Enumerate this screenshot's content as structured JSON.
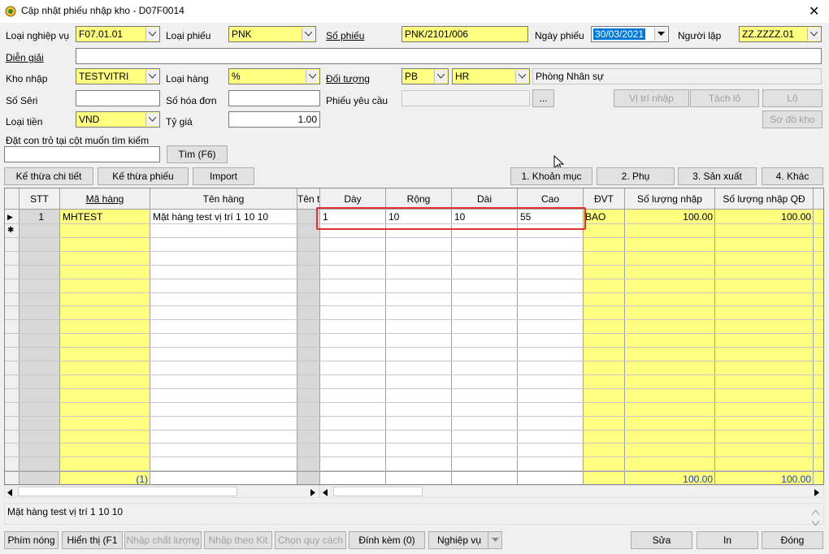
{
  "window": {
    "title": "Cập nhật phiếu nhập kho - D07F0014",
    "close_glyph": "✕"
  },
  "form": {
    "loai_nghiep_vu": {
      "label": "Loại nghiệp vụ",
      "value": "F07.01.01"
    },
    "loai_phieu": {
      "label": "Loại phiếu",
      "value": "PNK"
    },
    "so_phieu": {
      "label": "Số phiếu",
      "value": "PNK/2101/006"
    },
    "ngay_phieu": {
      "label": "Ngày phiếu",
      "value": "30/03/2021"
    },
    "nguoi_lap": {
      "label": "Người lập",
      "value": "ZZ.ZZZZ.01"
    },
    "dien_giai": {
      "label": "Diễn giải",
      "value": ""
    },
    "kho_nhap": {
      "label": "Kho nhập",
      "value": "TESTVITRI"
    },
    "loai_hang": {
      "label": "Loại hàng",
      "value": "%"
    },
    "doi_tuong": {
      "label": "Đối tượng",
      "value1": "PB",
      "value2": "HR",
      "name": "Phòng Nhân sự"
    },
    "so_seri": {
      "label": "Số Sêri",
      "value": ""
    },
    "so_hoa_don": {
      "label": "Số hóa đơn",
      "value": ""
    },
    "phieu_yeu_cau": {
      "label": "Phiếu yêu cầu",
      "value": "",
      "browse": "..."
    },
    "loai_tien": {
      "label": "Loại tiền",
      "value": "VND"
    },
    "ty_gia": {
      "label": "Tỷ giá",
      "value": "1.00"
    },
    "search": {
      "label": "Đặt con trỏ tại cột muốn tìm kiếm",
      "value": "",
      "button": "Tìm (F6)"
    }
  },
  "side_buttons": {
    "vi_tri_nhap": "Vị trí nhập",
    "tach_lo": "Tách lô",
    "lo": "Lô",
    "so_do_kho": "Sơ đồ kho"
  },
  "tabs_left": {
    "ke_thua_chi_tiet": "Kế thừa chi tiết",
    "ke_thua_phieu": "Kế thừa phiếu",
    "import": "Import"
  },
  "tabs_right": {
    "khoan_muc": "1. Khoản mục",
    "phu": "2. Phụ",
    "san_xuat": "3. Sản xuất",
    "khac": "4. Khác"
  },
  "grid": {
    "headers": {
      "stt": "STT",
      "ma_hang": "Mã hàng",
      "ten_hang": "Tên hàng",
      "ten_t": "Tên t",
      "day": "Dày",
      "rong": "Rộng",
      "dai": "Dài",
      "cao": "Cao",
      "dvt": "ĐVT",
      "sl_nhap": "Số lượng nhập",
      "sl_nhap_qd": "Số lượng nhập QĐ"
    },
    "row1": {
      "indicator": "▶",
      "stt": "1",
      "ma_hang": "MHTEST",
      "ten_hang": "Mặt hàng test vị trí 1 10 10",
      "day": "1",
      "rong": "10",
      "dai": "10",
      "cao": "55",
      "dvt": "BAO",
      "sl_nhap": "100.00",
      "sl_nhap_qd": "100.00"
    },
    "new_row_indicator": "✱",
    "footer": {
      "count": "(1)",
      "sl_nhap": "100.00",
      "sl_nhap_qd": "100.00"
    }
  },
  "status_text": "Mặt hàng test vị trí 1 10 10",
  "bottom_buttons": {
    "phim_nong": "Phím nóng",
    "hien_thi": "Hiển thị (F1",
    "nhap_chat_luong": "Nhập chất lượng",
    "nhap_theo_kit": "Nhập theo Kit",
    "chon_quy_cach": "Chọn quy cách",
    "dinh_kem": "Đính kèm (0)",
    "nghiep_vu": "Nghiệp vụ",
    "sua": "Sửa",
    "in": "In",
    "dong": "Đóng"
  },
  "colors": {
    "highlight": "#e03030",
    "yellow": "#ffff80",
    "selection": "#0078d7"
  }
}
